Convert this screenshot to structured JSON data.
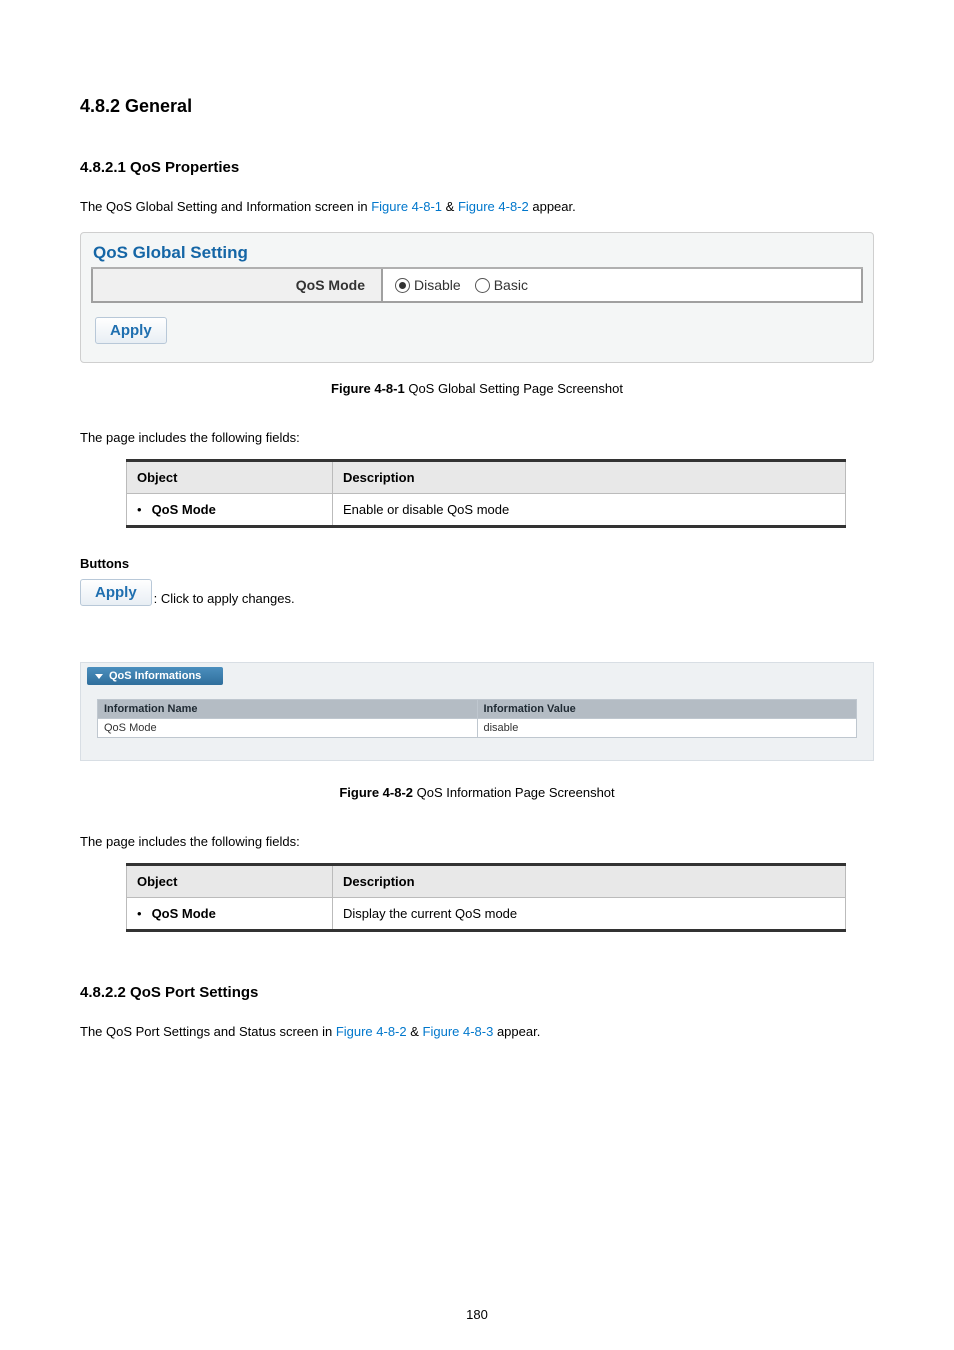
{
  "page_number": "180",
  "headings": {
    "h2": "4.8.2 General",
    "h3_1": "4.8.2.1 QoS Properties",
    "h3_2": "4.8.2.2 QoS Port Settings"
  },
  "intro1": {
    "pre": "The QoS Global Setting and Information screen in ",
    "link1": "Figure 4-8-1",
    "mid": " & ",
    "link2": "Figure 4-8-2",
    "post": " appear."
  },
  "screenshot1": {
    "title": "QoS Global Setting",
    "row_label": "QoS Mode",
    "opt_disable": "Disable",
    "opt_basic": "Basic",
    "apply": "Apply"
  },
  "caption1": {
    "bold": "Figure 4-8-1",
    "rest": " QoS Global Setting Page Screenshot"
  },
  "fields_intro": "The page includes the following fields:",
  "table1": {
    "h_object": "Object",
    "h_desc": "Description",
    "row_obj": "QoS Mode",
    "row_desc": "Enable or disable QoS mode"
  },
  "buttons_h": "Buttons",
  "apply_inline": "Apply",
  "apply_desc": ": Click to apply changes.",
  "screenshot2": {
    "bar": "QoS Informations",
    "h_name": "Information Name",
    "h_value": "Information Value",
    "r_name": "QoS Mode",
    "r_value": "disable"
  },
  "caption2": {
    "bold": "Figure 4-8-2",
    "rest": " QoS Information Page Screenshot"
  },
  "table2": {
    "h_object": "Object",
    "h_desc": "Description",
    "row_obj": "QoS Mode",
    "row_desc": "Display the current QoS mode"
  },
  "intro2": {
    "pre": "The QoS Port Settings and Status screen in ",
    "link1": "Figure 4-8-2",
    "mid": " & ",
    "link2": "Figure 4-8-3",
    "post": " appear."
  }
}
